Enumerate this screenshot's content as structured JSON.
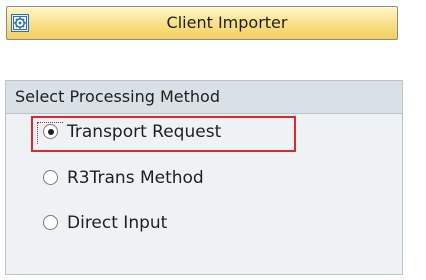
{
  "app_button": {
    "label": "Client Importer",
    "icon": "execute-gear-icon",
    "gradient_top": "#fff7c8",
    "gradient_bottom": "#f2cf5e"
  },
  "processing_group": {
    "title": "Select Processing Method",
    "options": [
      {
        "label": "Transport Request",
        "selected": true,
        "highlighted": true
      },
      {
        "label": "R3Trans Method",
        "selected": false,
        "highlighted": false
      },
      {
        "label": "Direct Input",
        "selected": false,
        "highlighted": false
      }
    ]
  },
  "colors": {
    "highlight_border": "#e2262e",
    "group_header_bg": "#d9e0e6",
    "group_body_bg": "#eef2f5"
  }
}
